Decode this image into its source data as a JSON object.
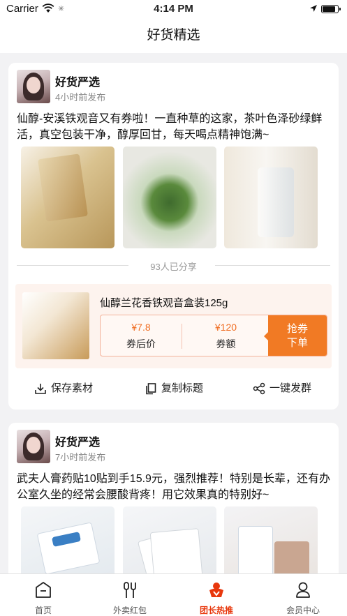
{
  "status_bar": {
    "carrier": "Carrier",
    "time": "4:14 PM",
    "battery_level": 0.95
  },
  "nav": {
    "title": "好货精选"
  },
  "posts": [
    {
      "author": "好货严选",
      "time": "4小时前发布",
      "content": "仙醇-安溪铁观音又有券啦！一直种草的这家，茶叶色泽砂绿鲜活，真空包装干净，醇厚回甘，每天喝点精神饱满~",
      "share_count": "93人已分享",
      "product": {
        "name": "仙醇兰花香铁观音盒装125g",
        "coupon_price": "¥7.8",
        "coupon_price_label": "券后价",
        "coupon_amount": "¥120",
        "coupon_amount_label": "券额",
        "grab_line1": "抢券",
        "grab_line2": "下单"
      },
      "actions": {
        "save": "保存素材",
        "copy": "复制标题",
        "share": "一键发群"
      }
    },
    {
      "author": "好货严选",
      "time": "7小时前发布",
      "content": "武夫人膏药贴10贴到手15.9元，强烈推荐！特别是长辈，还有办公室久坐的经常会腰酸背疼！用它效果真的特别好~"
    }
  ],
  "tabs": [
    {
      "label": "首页",
      "icon": "home-icon"
    },
    {
      "label": "外卖红包",
      "icon": "utensils-icon"
    },
    {
      "label": "团长热推",
      "icon": "hot-leader-icon"
    },
    {
      "label": "会员中心",
      "icon": "user-icon"
    }
  ],
  "active_tab": "团长热推",
  "colors": {
    "accent": "#f17a24",
    "active_tab": "#e8380d",
    "price": "#f06d22"
  }
}
